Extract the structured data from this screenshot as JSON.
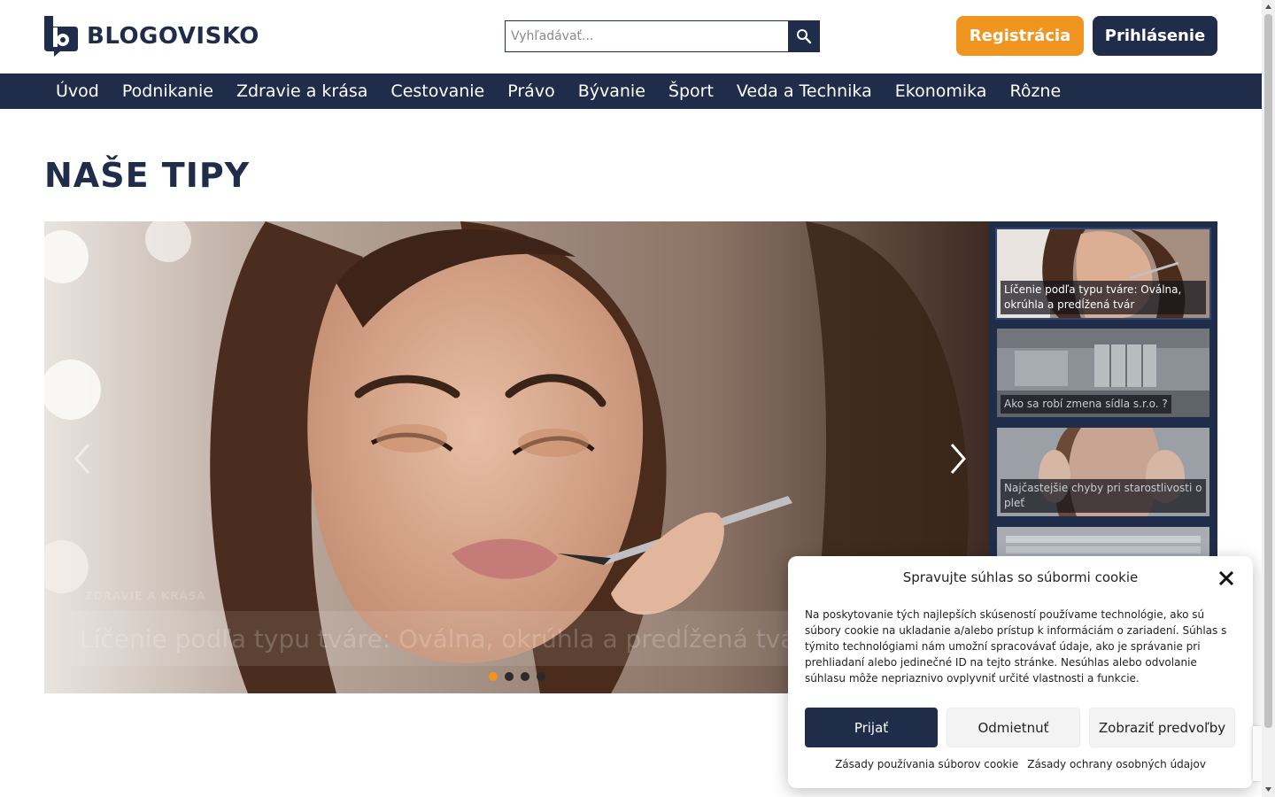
{
  "header": {
    "logo_text": "BLOGOVISKO",
    "search_placeholder": "Vyhľadávať...",
    "register_label": "Registrácia",
    "login_label": "Prihlásenie"
  },
  "nav": {
    "items": [
      "Úvod",
      "Podnikanie",
      "Zdravie a krása",
      "Cestovanie",
      "Právo",
      "Bývanie",
      "Šport",
      "Veda a Technika",
      "Ekonomika",
      "Rôzne"
    ]
  },
  "section": {
    "title": "NAŠE TIPY"
  },
  "slider": {
    "category": "ZDRAVIE A KRÁSA",
    "title": "Líčenie podľa typu tváre: Oválna, okrúhla a predĺžená tvár",
    "active_index": 0,
    "dot_count": 4
  },
  "thumbs": [
    {
      "label": "Líčenie podľa typu tváre: Oválna, okrúhla a predĺžená tvár"
    },
    {
      "label": "Ako sa robí zmena sídla s.r.o. ?"
    },
    {
      "label": "Najčastejšie chyby pri starostlivosti o pleť"
    },
    {
      "label": ""
    }
  ],
  "cookie": {
    "title": "Spravujte súhlas so súbormi cookie",
    "text": "Na poskytovanie tých najlepších skúseností používame technológie, ako sú súbory cookie na ukladanie a/alebo prístup k informáciám o zariadení. Súhlas s týmito technológiami nám umožní spracovávať údaje, ako je správanie pri prehliadaní alebo jedinečné ID na tejto stránke. Nesúhlas alebo odvolanie súhlasu môže nepriaznivo ovplyvniť určité vlastnosti a funkcie.",
    "accept_label": "Prijať",
    "deny_label": "Odmietnuť",
    "prefs_label": "Zobraziť predvoľby",
    "link_cookie_policy": "Zásady používania súborov cookie",
    "link_privacy": "Zásady ochrany osobných údajov"
  },
  "colors": {
    "brand_navy": "#1f2d4a",
    "accent_orange": "#f0951f"
  },
  "icons": {
    "search": "search-icon",
    "close": "close-icon",
    "prev": "chevron-left-icon",
    "next": "chevron-right-icon"
  }
}
